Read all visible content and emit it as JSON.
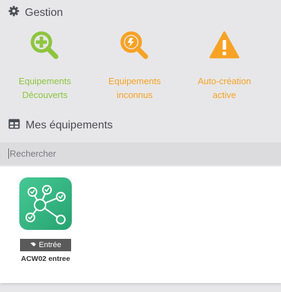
{
  "gestion": {
    "title": "Gestion",
    "icon": "gear-icon"
  },
  "actions": [
    {
      "label": "Equipements\nDécouverts",
      "icon": "search-plus-icon",
      "color": "#8dc53e"
    },
    {
      "label": "Equipements\ninconnus",
      "icon": "search-unknown-icon",
      "color": "#f7a224"
    },
    {
      "label": "Auto-création\nactive",
      "icon": "warning-icon",
      "color": "#f7a224"
    }
  ],
  "equipements": {
    "title": "Mes équipements",
    "icon": "table-icon"
  },
  "search": {
    "placeholder": "Rechercher",
    "value": ""
  },
  "devices": [
    {
      "badge": "Entrée",
      "badge_icon": "door-icon",
      "name": "ACW02 entree",
      "icon": "network-node-icon",
      "icon_color": "#33b37c"
    }
  ]
}
